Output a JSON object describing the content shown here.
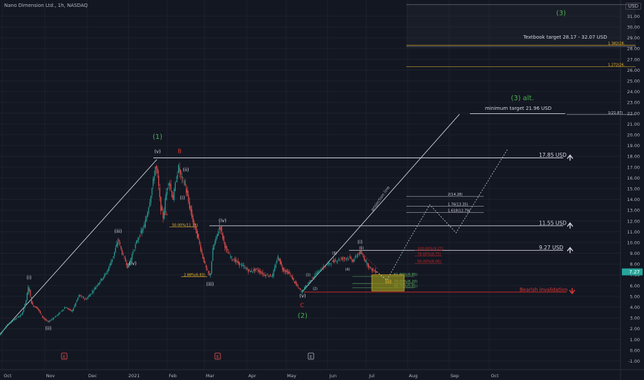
{
  "header": {
    "symbol": "Nano Dimension Ltd., 1h, NASDAQ",
    "currency": "USD"
  },
  "colors": {
    "bg": "#131722",
    "up": "#26a69a",
    "down": "#ef5350",
    "green_label": "#4caf50",
    "red_label": "#e53935",
    "line": "#d1d4dc",
    "fib_green": "#66bb6a",
    "fib_red": "#c62828",
    "gold": "#fbc02d",
    "box": "#8c8a1d",
    "axis_text": "#b2b5be",
    "last_price_bg": "#26a69a"
  },
  "chart_data": {
    "type": "candlestick",
    "title": "Nano Dimension Ltd., 1h, NASDAQ",
    "y_unit": "USD",
    "ylim": [
      -1.8,
      32.5
    ],
    "y_ticks": [
      31.0,
      30.0,
      29.0,
      28.0,
      27.0,
      26.0,
      25.0,
      24.0,
      23.0,
      22.0,
      21.0,
      20.0,
      19.0,
      18.0,
      17.0,
      16.0,
      15.0,
      14.0,
      13.0,
      12.0,
      11.0,
      10.0,
      9.0,
      8.0,
      7.0,
      6.0,
      5.0,
      4.0,
      3.0,
      2.0,
      1.0,
      0.0,
      -1.0
    ],
    "y_tick_labels": [
      "31.00",
      "30.00",
      "29.00",
      "28.00",
      "27.00",
      "26.00",
      "25.00",
      "24.00",
      "23.00",
      "22.00",
      "21.00",
      "20.00",
      "19.00",
      "18.00",
      "17.00",
      "16.00",
      "15.00",
      "14.00",
      "13.00",
      "12.00",
      "11.00",
      "10.00",
      "9.00",
      "8.00",
      "7.00",
      "6.00",
      "5.00",
      "4.00",
      "3.00",
      "2.00",
      "1.00",
      "0.00",
      "-1.00"
    ],
    "x_ticks": [
      {
        "t": 3,
        "label": "Oct"
      },
      {
        "t": 65,
        "label": "Nov"
      },
      {
        "t": 126,
        "label": "Dec"
      },
      {
        "t": 186,
        "label": "2021"
      },
      {
        "t": 242,
        "label": "Feb"
      },
      {
        "t": 296,
        "label": "Mar"
      },
      {
        "t": 357,
        "label": "Apr"
      },
      {
        "t": 414,
        "label": "May"
      },
      {
        "t": 474,
        "label": "Jun"
      },
      {
        "t": 530,
        "label": "Jul"
      },
      {
        "t": 590,
        "label": "Aug"
      },
      {
        "t": 650,
        "label": "Sep"
      },
      {
        "t": 708,
        "label": "Oct"
      }
    ],
    "last_price": 7.27,
    "last_price_label": "7.27",
    "price_path": [
      [
        0,
        1.4
      ],
      [
        10,
        2.3
      ],
      [
        22,
        2.9
      ],
      [
        32,
        3.3
      ],
      [
        38,
        4.5
      ],
      [
        42,
        6.0
      ],
      [
        47,
        4.2
      ],
      [
        55,
        3.9
      ],
      [
        62,
        3.1
      ],
      [
        70,
        2.6
      ],
      [
        78,
        3.0
      ],
      [
        86,
        3.4
      ],
      [
        95,
        4.0
      ],
      [
        105,
        3.6
      ],
      [
        115,
        5.1
      ],
      [
        125,
        4.7
      ],
      [
        135,
        5.5
      ],
      [
        145,
        6.4
      ],
      [
        155,
        7.2
      ],
      [
        165,
        8.8
      ],
      [
        172,
        10.3
      ],
      [
        177,
        9.1
      ],
      [
        186,
        7.7
      ],
      [
        192,
        8.9
      ],
      [
        200,
        10.3
      ],
      [
        210,
        11.6
      ],
      [
        217,
        13.7
      ],
      [
        222,
        15.5
      ],
      [
        226,
        17.2
      ],
      [
        229,
        16.1
      ],
      [
        233,
        13.3
      ],
      [
        237,
        12.3
      ],
      [
        241,
        14.5
      ],
      [
        245,
        15.8
      ],
      [
        251,
        14.0
      ],
      [
        255,
        15.6
      ],
      [
        259,
        17.0
      ],
      [
        263,
        16.0
      ],
      [
        268,
        15.5
      ],
      [
        273,
        13.9
      ],
      [
        280,
        12.0
      ],
      [
        287,
        10.5
      ],
      [
        294,
        8.7
      ],
      [
        300,
        7.4
      ],
      [
        305,
        6.8
      ],
      [
        309,
        9.5
      ],
      [
        314,
        10.5
      ],
      [
        319,
        11.6
      ],
      [
        323,
        10.5
      ],
      [
        328,
        9.3
      ],
      [
        335,
        8.6
      ],
      [
        343,
        8.2
      ],
      [
        352,
        7.8
      ],
      [
        362,
        7.3
      ],
      [
        372,
        7.5
      ],
      [
        383,
        7.0
      ],
      [
        395,
        6.9
      ],
      [
        403,
        8.7
      ],
      [
        410,
        7.5
      ],
      [
        420,
        7.1
      ],
      [
        428,
        6.2
      ],
      [
        437,
        5.4
      ],
      [
        445,
        6.1
      ],
      [
        455,
        6.9
      ],
      [
        465,
        7.5
      ],
      [
        475,
        8.0
      ],
      [
        485,
        8.3
      ],
      [
        495,
        8.5
      ],
      [
        505,
        8.6
      ],
      [
        512,
        8.3
      ],
      [
        518,
        8.9
      ],
      [
        522,
        9.1
      ],
      [
        527,
        8.6
      ],
      [
        533,
        7.9
      ],
      [
        540,
        7.4
      ],
      [
        545,
        7.3
      ]
    ],
    "lines": [
      {
        "kind": "trend",
        "t1": 0,
        "p1": 1.5,
        "t2": 227,
        "p2": 17.7
      },
      {
        "kind": "projection",
        "t1": 437,
        "p1": 5.4,
        "t2": 665,
        "p2": 21.9
      },
      {
        "kind": "h",
        "t1": 222,
        "t2": 815,
        "p": 17.85
      },
      {
        "kind": "h",
        "t1": 303,
        "t2": 815,
        "p": 11.55
      },
      {
        "kind": "h",
        "t1": 505,
        "t2": 815,
        "p": 9.27
      }
    ],
    "projection_path": [
      [
        545,
        7.3
      ],
      [
        560,
        6.5
      ],
      [
        590,
        10.0
      ],
      [
        622,
        13.5
      ],
      [
        660,
        10.9
      ],
      [
        735,
        18.7
      ]
    ],
    "textbook_target": {
      "t1": 588,
      "t2": 920,
      "p1": 28.17,
      "p2": 32.07
    },
    "fib_levels": [
      {
        "label": "61.80%(6.85)",
        "p": 6.85,
        "t1": 510,
        "t2": 600,
        "color_key": "fib_green"
      },
      {
        "label": "78.60%(6.20)",
        "p": 6.2,
        "t1": 510,
        "t2": 600,
        "color_key": "fib_green"
      },
      {
        "label": "88.70%(5.81)",
        "p": 5.81,
        "t1": 510,
        "t2": 600,
        "color_key": "fib_green"
      },
      {
        "label": "100.00%(9.27)",
        "p": 9.27,
        "t1": 600,
        "t2": 640,
        "color_key": "fib_red"
      },
      {
        "label": "78.60%(8.75)",
        "p": 8.75,
        "t1": 600,
        "t2": 640,
        "color_key": "fib_red"
      },
      {
        "label": "50.00%(8.06)",
        "p": 8.06,
        "t1": 600,
        "t2": 640,
        "color_key": "fib_red"
      },
      {
        "label": "2(14.28)",
        "p": 14.28,
        "t1": 588,
        "t2": 700,
        "color_key": "line"
      },
      {
        "label": "1.76(13.35)",
        "p": 13.35,
        "t1": 588,
        "t2": 700,
        "color_key": "line"
      },
      {
        "label": "1.618(12.79)",
        "p": 12.79,
        "t1": 588,
        "t2": 700,
        "color_key": "line"
      },
      {
        "label": "1.382(28.",
        "p": 28.3,
        "t1": 588,
        "t2": 920,
        "color_key": "gold"
      },
      {
        "label": "1.272(26.",
        "p": 26.3,
        "t1": 588,
        "t2": 920,
        "color_key": "gold"
      },
      {
        "label": "1(21.87)",
        "p": 21.87,
        "t1": 820,
        "t2": 920,
        "color_key": "line"
      },
      {
        "label": "50.00%(11.32)",
        "p": 11.45,
        "t1": 245,
        "t2": 285,
        "color_key": "gold"
      },
      {
        "label": "2.88%(6.83)",
        "p": 6.83,
        "t1": 262,
        "t2": 300,
        "color_key": "gold"
      }
    ],
    "zone_box": {
      "t1": 538,
      "t2": 585,
      "p_top": 7.0,
      "p_bottom": 5.5
    },
    "invalidation": {
      "label": "Bearish invalidation",
      "p": 5.4,
      "t1": 440,
      "t2": 820
    },
    "price_targets": [
      {
        "label": "17.85 USD",
        "p": 17.85
      },
      {
        "label": "11.55 USD",
        "p": 11.55
      },
      {
        "label": "9.27 USD",
        "p": 9.27
      }
    ],
    "annotations": [
      {
        "text": "(1)",
        "t": 228,
        "p": 19.6,
        "color_key": "green_label",
        "size": 10
      },
      {
        "text": "(2)",
        "t": 438,
        "p": 3.0,
        "color_key": "green_label",
        "size": 10
      },
      {
        "text": "(3)",
        "t": 812,
        "p": 31.1,
        "color_key": "green_label",
        "size": 10
      },
      {
        "text": "(3) alt.",
        "t": 756,
        "p": 23.2,
        "color_key": "green_label",
        "size": 10
      },
      {
        "text": "B",
        "t": 260,
        "p": 18.3,
        "color_key": "red_label",
        "size": 8
      },
      {
        "text": "A",
        "t": 240,
        "p": 12.5,
        "color_key": "red_label",
        "size": 8
      },
      {
        "text": "C",
        "t": 437,
        "p": 4.0,
        "color_key": "red_label",
        "size": 8
      },
      {
        "text": "(v)",
        "t": 228,
        "p": 18.3,
        "color_key": "line",
        "size": 7
      },
      {
        "text": "(ii)",
        "t": 269,
        "p": 16.6,
        "color_key": "line",
        "size": 7
      },
      {
        "text": "(i)",
        "t": 264,
        "p": 14.0,
        "color_key": "line",
        "size": 7
      },
      {
        "text": "(iii)",
        "t": 171,
        "p": 10.9,
        "color_key": "line",
        "size": 7
      },
      {
        "text": "(iv)",
        "t": 192,
        "p": 7.9,
        "color_key": "line",
        "size": 7
      },
      {
        "text": "(i)",
        "t": 42,
        "p": 6.6,
        "color_key": "line",
        "size": 7
      },
      {
        "text": "(ii)",
        "t": 70,
        "p": 1.9,
        "color_key": "line",
        "size": 7
      },
      {
        "text": "(iv)",
        "t": 322,
        "p": 11.9,
        "color_key": "line",
        "size": 7
      },
      {
        "text": "(iii)",
        "t": 304,
        "p": 6.0,
        "color_key": "line",
        "size": 7
      },
      {
        "text": "(v)",
        "t": 438,
        "p": 4.9,
        "color_key": "line",
        "size": 7
      },
      {
        "text": "(i)",
        "t": 521,
        "p": 9.9,
        "color_key": "line",
        "size": 7
      },
      {
        "text": "(ii)",
        "t": 562,
        "p": 6.2,
        "color_key": "gold",
        "size": 7
      },
      {
        "text": "(5)",
        "t": 523,
        "p": 9.4,
        "color_key": "line",
        "size": 5
      },
      {
        "text": "(3)",
        "t": 484,
        "p": 8.9,
        "color_key": "line",
        "size": 5
      },
      {
        "text": "(1)",
        "t": 446,
        "p": 6.9,
        "color_key": "line",
        "size": 5
      },
      {
        "text": "(2)",
        "t": 456,
        "p": 5.6,
        "color_key": "line",
        "size": 5
      },
      {
        "text": "(4)",
        "t": 503,
        "p": 7.4,
        "color_key": "line",
        "size": 5
      },
      {
        "text": "minimum target 21.96 USD",
        "t": 750,
        "p": 22.3,
        "color_key": "line",
        "size": 7
      },
      {
        "text": "Textbook target 28.17 - 32.07 USD",
        "t": 818,
        "p": 28.9,
        "color_key": "line",
        "size": 7
      },
      {
        "text": "projection line",
        "t": 552,
        "p": 14.0,
        "color_key": "axis_text",
        "size": 6,
        "rotate": -55
      }
    ],
    "event_markers": [
      {
        "t": 93,
        "label": "E",
        "color_key": "down"
      },
      {
        "t": 315,
        "label": "E",
        "color_key": "down"
      },
      {
        "t": 450,
        "label": "E",
        "color_key": "axis_text"
      }
    ]
  }
}
